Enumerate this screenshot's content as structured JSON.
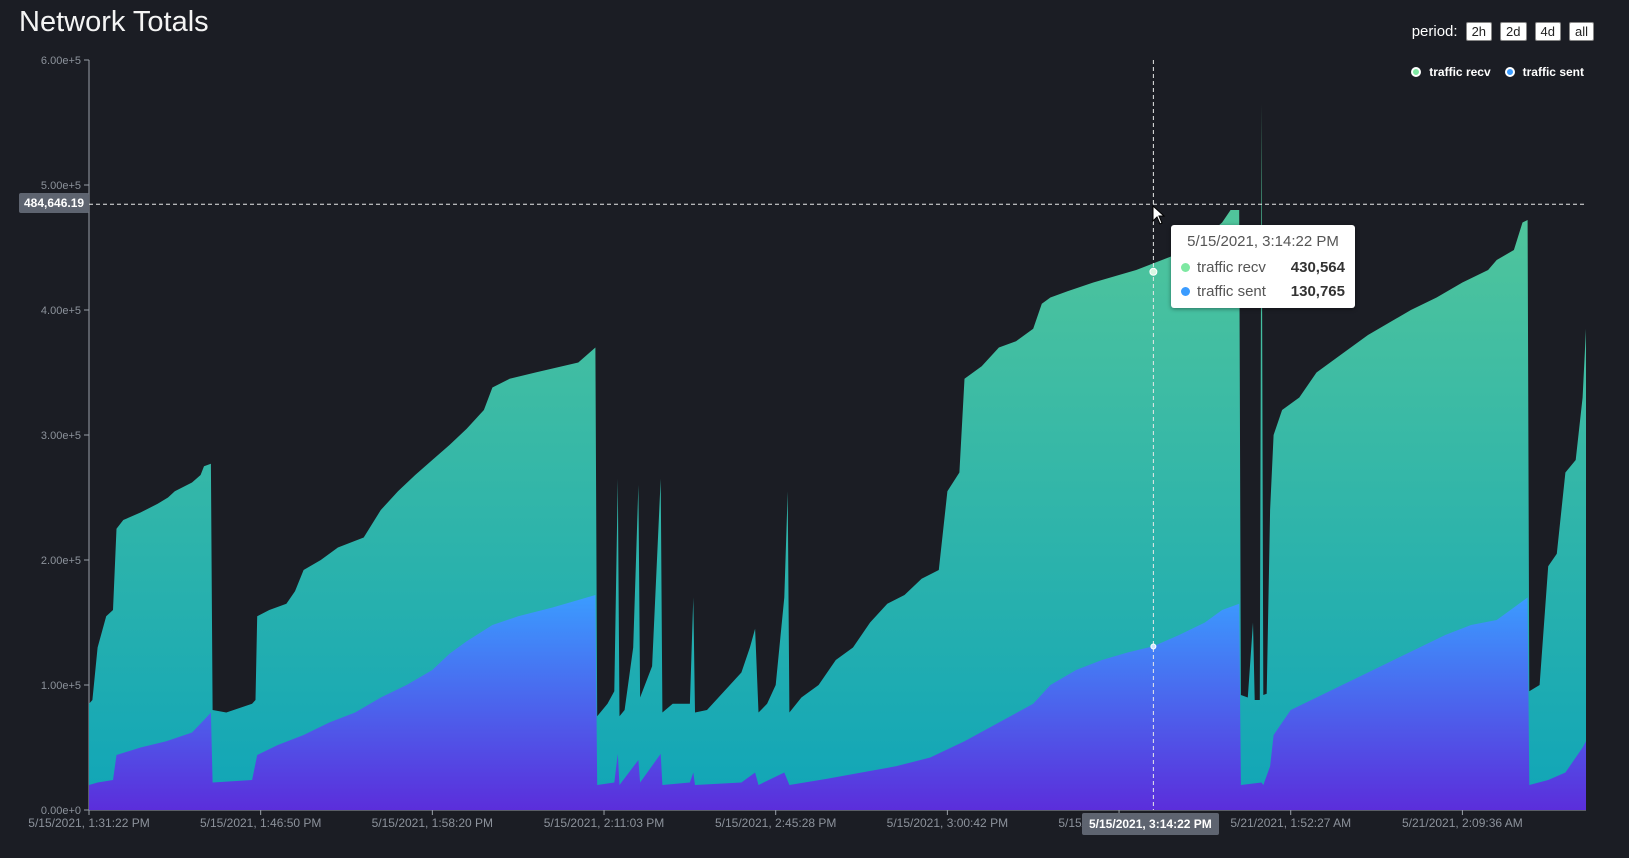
{
  "title": "Network Totals",
  "period": {
    "label": "period:",
    "options": [
      "2h",
      "2d",
      "4d",
      "all"
    ]
  },
  "legend": {
    "items": [
      {
        "label": "traffic recv",
        "color": "#7ee8a2"
      },
      {
        "label": "traffic sent",
        "color": "#3b9cff"
      }
    ]
  },
  "crosshair": {
    "y_label": "484,646.19",
    "x_label": "5/15/2021, 3:14:22 PM",
    "y_value": 484646.19,
    "x_index": 6.2
  },
  "tooltip": {
    "title": "5/15/2021, 3:14:22 PM",
    "rows": [
      {
        "name": "traffic recv",
        "value": "430,564",
        "color": "#7ee8a2"
      },
      {
        "name": "traffic sent",
        "value": "130,765",
        "color": "#3b9cff"
      }
    ]
  },
  "colors": {
    "background": "#1b1d24",
    "recv_top": "#5ccb96",
    "recv_bottom": "#10a5b8",
    "sent_top": "#3b9cff",
    "sent_bottom": "#5b2edb"
  },
  "chart_data": {
    "type": "area",
    "ylim": [
      0,
      600000
    ],
    "y_ticks": [
      "0.00e+0",
      "1.00e+5",
      "2.00e+5",
      "3.00e+5",
      "4.00e+5",
      "5.00e+5",
      "6.00e+5"
    ],
    "y_tick_values": [
      0,
      100000,
      200000,
      300000,
      400000,
      500000,
      600000
    ],
    "x_ticks": [
      "5/15/2021, 1:31:22 PM",
      "5/15/2021, 1:46:50 PM",
      "5/15/2021, 1:58:20 PM",
      "5/15/2021, 2:11:03 PM",
      "5/15/2021, 2:45:28 PM",
      "5/15/2021, 3:00:42 PM",
      "5/15/2021, 3:14:22 PM",
      "5/21/2021, 1:52:27 AM",
      "5/21/2021, 2:09:36 AM"
    ],
    "xlim": [
      0,
      8.72
    ],
    "series": [
      {
        "name": "traffic recv",
        "points": [
          [
            0,
            85000
          ],
          [
            0.02,
            88000
          ],
          [
            0.05,
            130000
          ],
          [
            0.1,
            155000
          ],
          [
            0.14,
            160000
          ],
          [
            0.16,
            225000
          ],
          [
            0.2,
            232000
          ],
          [
            0.3,
            238000
          ],
          [
            0.4,
            245000
          ],
          [
            0.46,
            250000
          ],
          [
            0.5,
            255000
          ],
          [
            0.6,
            262000
          ],
          [
            0.65,
            268000
          ],
          [
            0.67,
            275000
          ],
          [
            0.71,
            277000
          ],
          [
            0.72,
            80000
          ],
          [
            0.8,
            78000
          ],
          [
            0.95,
            85000
          ],
          [
            0.97,
            88000
          ],
          [
            0.98,
            155000
          ],
          [
            1.05,
            160000
          ],
          [
            1.15,
            165000
          ],
          [
            1.2,
            175000
          ],
          [
            1.25,
            192000
          ],
          [
            1.35,
            200000
          ],
          [
            1.45,
            210000
          ],
          [
            1.6,
            218000
          ],
          [
            1.7,
            240000
          ],
          [
            1.8,
            255000
          ],
          [
            1.9,
            268000
          ],
          [
            2.0,
            280000
          ],
          [
            2.1,
            292000
          ],
          [
            2.2,
            305000
          ],
          [
            2.3,
            320000
          ],
          [
            2.35,
            338000
          ],
          [
            2.45,
            345000
          ],
          [
            2.6,
            350000
          ],
          [
            2.85,
            358000
          ],
          [
            2.95,
            370000
          ],
          [
            2.96,
            75000
          ],
          [
            3.02,
            85000
          ],
          [
            3.06,
            95000
          ],
          [
            3.08,
            265000
          ],
          [
            3.09,
            75000
          ],
          [
            3.12,
            80000
          ],
          [
            3.17,
            130000
          ],
          [
            3.2,
            260000
          ],
          [
            3.21,
            90000
          ],
          [
            3.28,
            115000
          ],
          [
            3.33,
            265000
          ],
          [
            3.34,
            78000
          ],
          [
            3.4,
            85000
          ],
          [
            3.5,
            85000
          ],
          [
            3.52,
            170000
          ],
          [
            3.53,
            78000
          ],
          [
            3.6,
            80000
          ],
          [
            3.7,
            95000
          ],
          [
            3.8,
            110000
          ],
          [
            3.85,
            130000
          ],
          [
            3.88,
            145000
          ],
          [
            3.9,
            78000
          ],
          [
            3.95,
            85000
          ],
          [
            4.0,
            100000
          ],
          [
            4.05,
            170000
          ],
          [
            4.07,
            255000
          ],
          [
            4.08,
            78000
          ],
          [
            4.15,
            90000
          ],
          [
            4.25,
            100000
          ],
          [
            4.35,
            120000
          ],
          [
            4.45,
            130000
          ],
          [
            4.55,
            150000
          ],
          [
            4.65,
            165000
          ],
          [
            4.75,
            172000
          ],
          [
            4.85,
            185000
          ],
          [
            4.95,
            192000
          ],
          [
            5.0,
            255000
          ],
          [
            5.07,
            270000
          ],
          [
            5.1,
            345000
          ],
          [
            5.2,
            355000
          ],
          [
            5.3,
            370000
          ],
          [
            5.4,
            375000
          ],
          [
            5.5,
            385000
          ],
          [
            5.55,
            405000
          ],
          [
            5.6,
            410000
          ],
          [
            5.7,
            415000
          ],
          [
            5.85,
            422000
          ],
          [
            6.0,
            428000
          ],
          [
            6.1,
            432000
          ],
          [
            6.25,
            440000
          ],
          [
            6.4,
            448000
          ],
          [
            6.5,
            458000
          ],
          [
            6.6,
            470000
          ],
          [
            6.65,
            480000
          ],
          [
            6.7,
            480000
          ],
          [
            6.71,
            92000
          ],
          [
            6.75,
            90000
          ],
          [
            6.78,
            150000
          ],
          [
            6.79,
            88000
          ],
          [
            6.82,
            88000
          ],
          [
            6.83,
            565000
          ],
          [
            6.84,
            92000
          ],
          [
            6.86,
            93000
          ],
          [
            6.88,
            240000
          ],
          [
            6.9,
            300000
          ],
          [
            6.95,
            320000
          ],
          [
            7.05,
            330000
          ],
          [
            7.15,
            350000
          ],
          [
            7.3,
            365000
          ],
          [
            7.45,
            380000
          ],
          [
            7.6,
            392000
          ],
          [
            7.7,
            400000
          ],
          [
            7.85,
            410000
          ],
          [
            8.0,
            422000
          ],
          [
            8.15,
            432000
          ],
          [
            8.2,
            440000
          ],
          [
            8.3,
            448000
          ],
          [
            8.35,
            470000
          ],
          [
            8.38,
            472000
          ],
          [
            8.39,
            95000
          ],
          [
            8.45,
            100000
          ],
          [
            8.5,
            195000
          ],
          [
            8.55,
            205000
          ],
          [
            8.6,
            270000
          ],
          [
            8.66,
            280000
          ],
          [
            8.7,
            330000
          ],
          [
            8.72,
            385000
          ]
        ]
      },
      {
        "name": "traffic sent",
        "points": [
          [
            0,
            20000
          ],
          [
            0.05,
            22000
          ],
          [
            0.14,
            24000
          ],
          [
            0.16,
            44000
          ],
          [
            0.3,
            50000
          ],
          [
            0.45,
            55000
          ],
          [
            0.6,
            62000
          ],
          [
            0.67,
            72000
          ],
          [
            0.71,
            78000
          ],
          [
            0.72,
            22000
          ],
          [
            0.95,
            24000
          ],
          [
            0.98,
            44000
          ],
          [
            1.1,
            52000
          ],
          [
            1.25,
            60000
          ],
          [
            1.4,
            70000
          ],
          [
            1.55,
            78000
          ],
          [
            1.7,
            90000
          ],
          [
            1.85,
            100000
          ],
          [
            2.0,
            112000
          ],
          [
            2.1,
            125000
          ],
          [
            2.2,
            135000
          ],
          [
            2.35,
            148000
          ],
          [
            2.5,
            155000
          ],
          [
            2.7,
            162000
          ],
          [
            2.85,
            168000
          ],
          [
            2.95,
            172000
          ],
          [
            2.96,
            20000
          ],
          [
            3.06,
            22000
          ],
          [
            3.08,
            45000
          ],
          [
            3.09,
            20000
          ],
          [
            3.2,
            40000
          ],
          [
            3.21,
            22000
          ],
          [
            3.33,
            45000
          ],
          [
            3.34,
            20000
          ],
          [
            3.5,
            22000
          ],
          [
            3.52,
            30000
          ],
          [
            3.53,
            20000
          ],
          [
            3.8,
            22000
          ],
          [
            3.88,
            30000
          ],
          [
            3.9,
            20000
          ],
          [
            4.05,
            30000
          ],
          [
            4.08,
            20000
          ],
          [
            4.3,
            25000
          ],
          [
            4.5,
            30000
          ],
          [
            4.7,
            35000
          ],
          [
            4.9,
            42000
          ],
          [
            5.1,
            55000
          ],
          [
            5.3,
            70000
          ],
          [
            5.5,
            85000
          ],
          [
            5.6,
            100000
          ],
          [
            5.75,
            112000
          ],
          [
            5.9,
            120000
          ],
          [
            6.05,
            126000
          ],
          [
            6.2,
            131000
          ],
          [
            6.35,
            140000
          ],
          [
            6.5,
            150000
          ],
          [
            6.6,
            160000
          ],
          [
            6.7,
            165000
          ],
          [
            6.71,
            20000
          ],
          [
            6.83,
            22000
          ],
          [
            6.84,
            20000
          ],
          [
            6.88,
            35000
          ],
          [
            6.9,
            60000
          ],
          [
            7.0,
            80000
          ],
          [
            7.15,
            90000
          ],
          [
            7.3,
            100000
          ],
          [
            7.45,
            110000
          ],
          [
            7.6,
            120000
          ],
          [
            7.75,
            130000
          ],
          [
            7.9,
            140000
          ],
          [
            8.05,
            148000
          ],
          [
            8.2,
            152000
          ],
          [
            8.3,
            162000
          ],
          [
            8.38,
            170000
          ],
          [
            8.39,
            20000
          ],
          [
            8.5,
            24000
          ],
          [
            8.6,
            30000
          ],
          [
            8.7,
            50000
          ],
          [
            8.72,
            55000
          ]
        ]
      }
    ]
  }
}
